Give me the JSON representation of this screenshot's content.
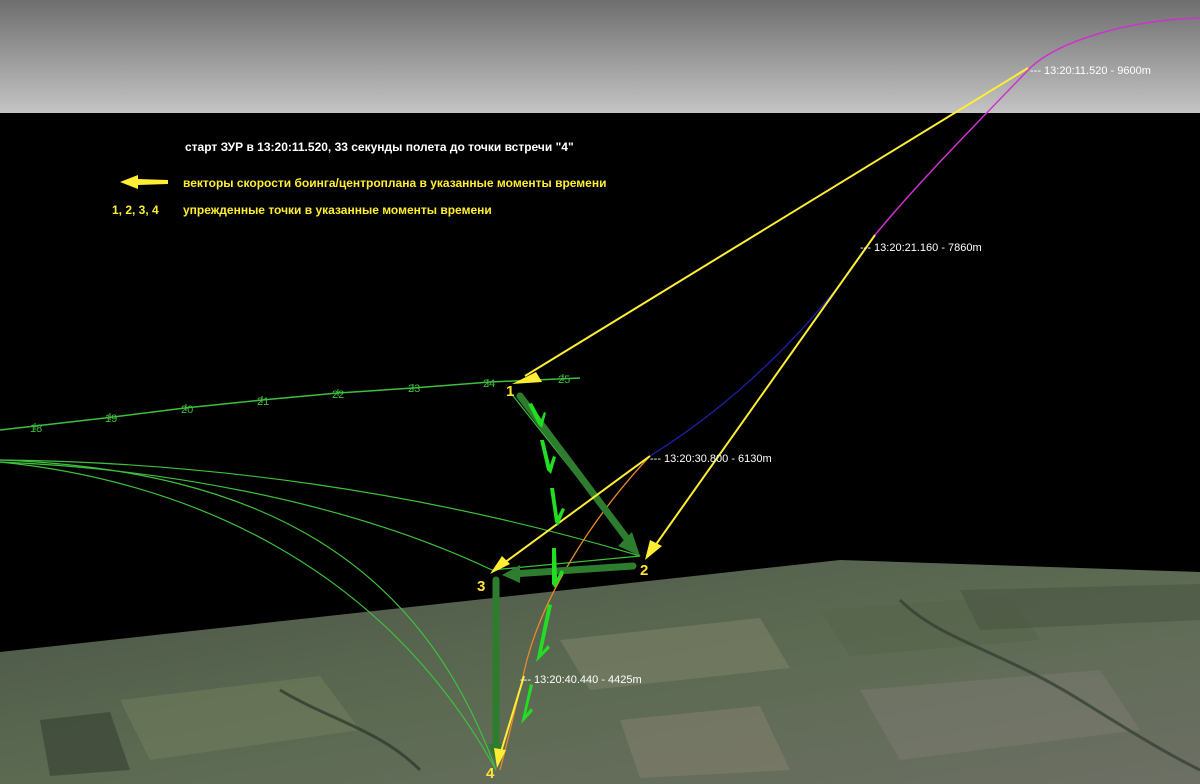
{
  "legend": {
    "title": "старт ЗУР в 13:20:11.520, 33 секунды полета до точки встречи \"4\"",
    "vectors_text": "векторы скорости боинга/центроплана в указанные моменты времени",
    "points_key": "1, 2, 3, 4",
    "points_text": "упрежденные точки в указанные моменты времени"
  },
  "time_labels": [
    "--- 13:20:11.520 - 9600m",
    "--- 13:20:21.160 - 7860m",
    "--- 13:20:30.800 - 6130m",
    "--- 13:20:40.440 - 4425m"
  ],
  "track_ticks": [
    "18",
    "19",
    "20",
    "21",
    "22",
    "23",
    "24",
    "25"
  ],
  "points": [
    "1",
    "2",
    "3",
    "4"
  ],
  "colors": {
    "background": "#000000",
    "sky": "#a8a8a8",
    "track": "#3fbf3f",
    "vector": "#ffee33",
    "arrow": "#22dd22",
    "missile_high": "#cc33cc",
    "missile_mid": "#1a1a99",
    "missile_low": "#e88a2a"
  }
}
